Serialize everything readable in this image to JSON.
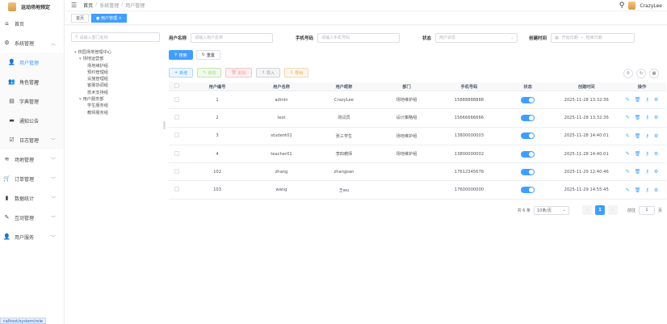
{
  "app": {
    "title": "运动场地预定"
  },
  "sidebar": {
    "items": [
      {
        "label": "首页",
        "icon": "home-icon"
      },
      {
        "label": "系统管理",
        "icon": "gear-icon",
        "expanded": true
      },
      {
        "label": "用户管理",
        "icon": "user-icon",
        "active": true
      },
      {
        "label": "角色管理",
        "icon": "user-group-icon"
      },
      {
        "label": "字典管理",
        "icon": "book-icon"
      },
      {
        "label": "通知公告",
        "icon": "message-icon"
      },
      {
        "label": "日志管理",
        "icon": "log-icon"
      },
      {
        "label": "场地管理",
        "icon": "field-icon"
      },
      {
        "label": "订单管理",
        "icon": "cart-icon"
      },
      {
        "label": "数据统计",
        "icon": "chart-icon"
      },
      {
        "label": "互动管理",
        "icon": "chat-icon"
      },
      {
        "label": "用户服务",
        "icon": "service-icon"
      }
    ]
  },
  "status_url": "calhost/system/role",
  "header": {
    "breadcrumb": [
      "首页",
      "系统管理",
      "用户管理"
    ],
    "username": "CrazyLee"
  },
  "tags": [
    "首页",
    "用户管理"
  ],
  "dept": {
    "search_placeholder": "请输入部门名称",
    "tree": [
      {
        "label": "校园场地管理中心",
        "level": 0
      },
      {
        "label": "场地运营部",
        "level": 1
      },
      {
        "label": "场地维护组",
        "level": 2
      },
      {
        "label": "预约管理组",
        "level": 2
      },
      {
        "label": "设施管理组",
        "level": 2
      },
      {
        "label": "客服协调组",
        "level": 2
      },
      {
        "label": "技术支持组",
        "level": 2
      },
      {
        "label": "用户服务部",
        "level": 1
      },
      {
        "label": "学生服务组",
        "level": 2
      },
      {
        "label": "教师服务组",
        "level": 2
      }
    ]
  },
  "filters": {
    "username_label": "用户名称",
    "username_placeholder": "请输入用户名称",
    "phone_label": "手机号码",
    "phone_placeholder": "请输入手机号码",
    "status_label": "状态",
    "status_placeholder": "用户状态",
    "created_label": "创建时间",
    "start_placeholder": "开始日期",
    "range_sep": "-",
    "end_placeholder": "结束日期"
  },
  "buttons": {
    "search": "搜索",
    "reset": "重置",
    "add": "新增",
    "edit": "修改",
    "delete": "删除",
    "import": "导入",
    "export": "导出"
  },
  "table": {
    "headers": [
      "用户编号",
      "用户名称",
      "用户昵称",
      "部门",
      "手机号码",
      "状态",
      "创建时间",
      "操作"
    ],
    "rows": [
      {
        "id": "1",
        "username": "admin",
        "nickname": "CrazyLee",
        "dept": "场地维护组",
        "phone": "15888888888",
        "status_on": true,
        "created": "2025-11-28 13:32:36"
      },
      {
        "id": "2",
        "username": "test",
        "nickname": "测试员",
        "dept": "设计策略组",
        "phone": "15666666666",
        "status_on": true,
        "created": "2025-11-28 13:32:36"
      },
      {
        "id": "3",
        "username": "student01",
        "nickname": "张三学生",
        "dept": "场地维护组",
        "phone": "13800000003",
        "status_on": true,
        "created": "2025-11-28 14:40:01"
      },
      {
        "id": "4",
        "username": "teacher01",
        "nickname": "李四教师",
        "dept": "场地维护组",
        "phone": "13800000002",
        "status_on": true,
        "created": "2025-11-28 14:40:01"
      },
      {
        "id": "102",
        "username": "zhang",
        "nickname": "zhangsan",
        "dept": "",
        "phone": "17612345678",
        "status_on": true,
        "created": "2025-11-29 12:40:46"
      },
      {
        "id": "103",
        "username": "wang",
        "nickname": "王wu",
        "dept": "",
        "phone": "17600000000",
        "status_on": true,
        "created": "2025-11-29 14:55:45"
      }
    ]
  },
  "pagination": {
    "total": "共 6 条",
    "page_size": "10条/页",
    "prev": "‹",
    "current": "1",
    "next": "›",
    "jump_label": "前往",
    "jump_value": "1",
    "page_suffix": "页"
  },
  "colors": {
    "primary": "#409eff"
  }
}
